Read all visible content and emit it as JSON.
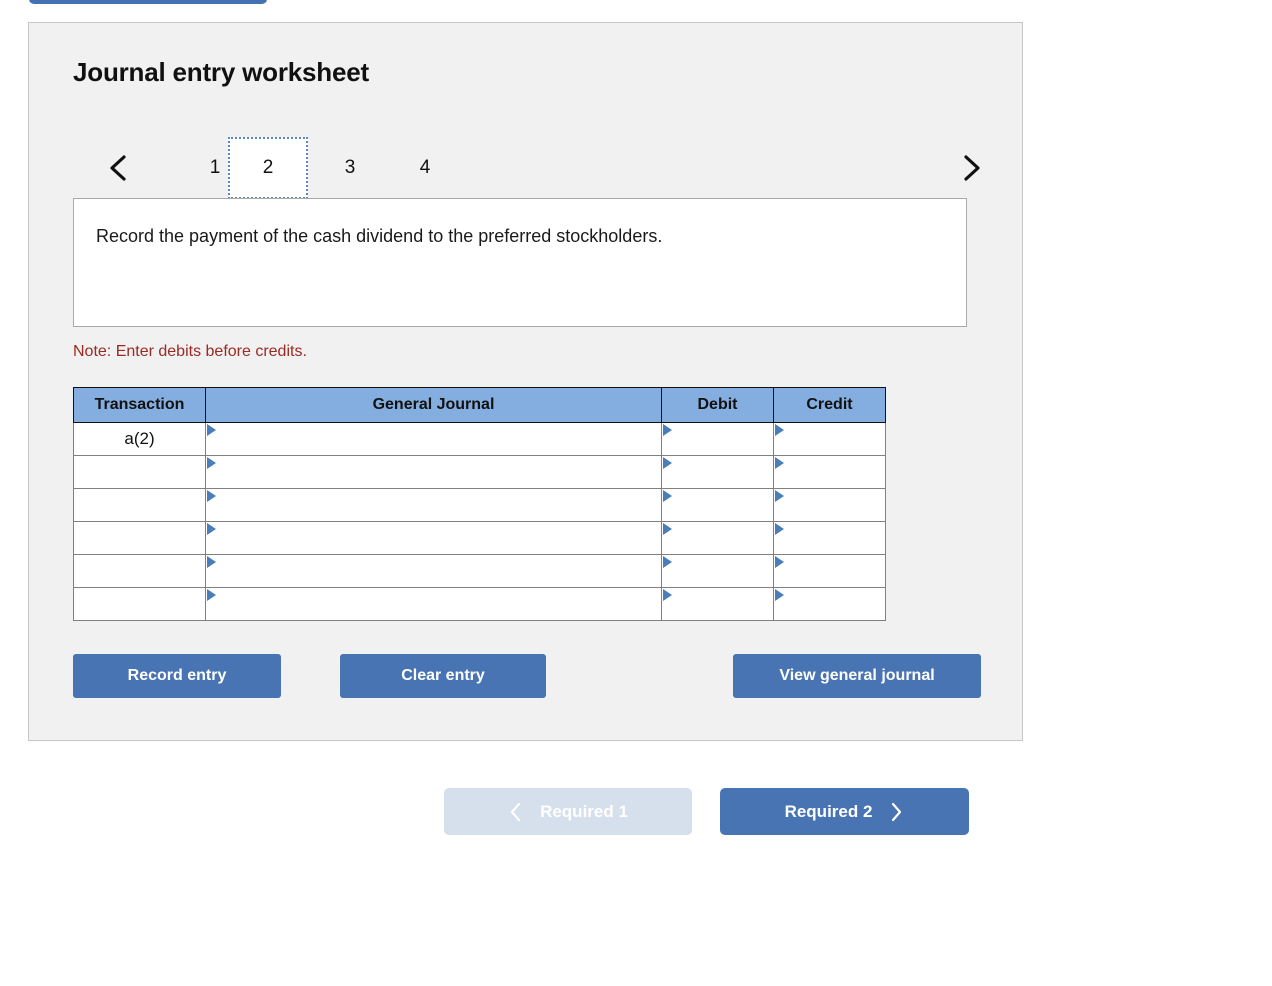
{
  "top_partial_button": {
    "name": "cut-off-blue-button"
  },
  "panel": {
    "title": "Journal entry worksheet",
    "tabs": {
      "prev_icon": "chevron-left-icon",
      "next_icon": "chevron-right-icon",
      "items": [
        {
          "label": "1",
          "active": false
        },
        {
          "label": "2",
          "active": true
        },
        {
          "label": "3",
          "active": false
        },
        {
          "label": "4",
          "active": false
        }
      ]
    },
    "description": "Record the payment of the cash dividend to the preferred stockholders.",
    "note": "Note: Enter debits before credits.",
    "table": {
      "headers": [
        "Transaction",
        "General Journal",
        "Debit",
        "Credit"
      ],
      "rows": [
        {
          "transaction": "a(2)",
          "general_journal": "",
          "debit": "",
          "credit": ""
        },
        {
          "transaction": "",
          "general_journal": "",
          "debit": "",
          "credit": ""
        },
        {
          "transaction": "",
          "general_journal": "",
          "debit": "",
          "credit": ""
        },
        {
          "transaction": "",
          "general_journal": "",
          "debit": "",
          "credit": ""
        },
        {
          "transaction": "",
          "general_journal": "",
          "debit": "",
          "credit": ""
        },
        {
          "transaction": "",
          "general_journal": "",
          "debit": "",
          "credit": ""
        }
      ]
    },
    "actions": {
      "record_entry": "Record entry",
      "clear_entry": "Clear entry",
      "view_general_journal": "View general journal"
    }
  },
  "footer_nav": {
    "prev": {
      "label": "Required 1",
      "icon": "chevron-left-icon",
      "disabled": true
    },
    "next": {
      "label": "Required 2",
      "icon": "chevron-right-icon",
      "disabled": false
    }
  },
  "colors": {
    "accent_blue": "#4874b4",
    "header_blue": "#84aee0",
    "panel_bg": "#f1f1f1",
    "note_red": "#9b2a23",
    "marker_blue": "#4a7ebb",
    "disabled_blue": "#d6dfec"
  }
}
